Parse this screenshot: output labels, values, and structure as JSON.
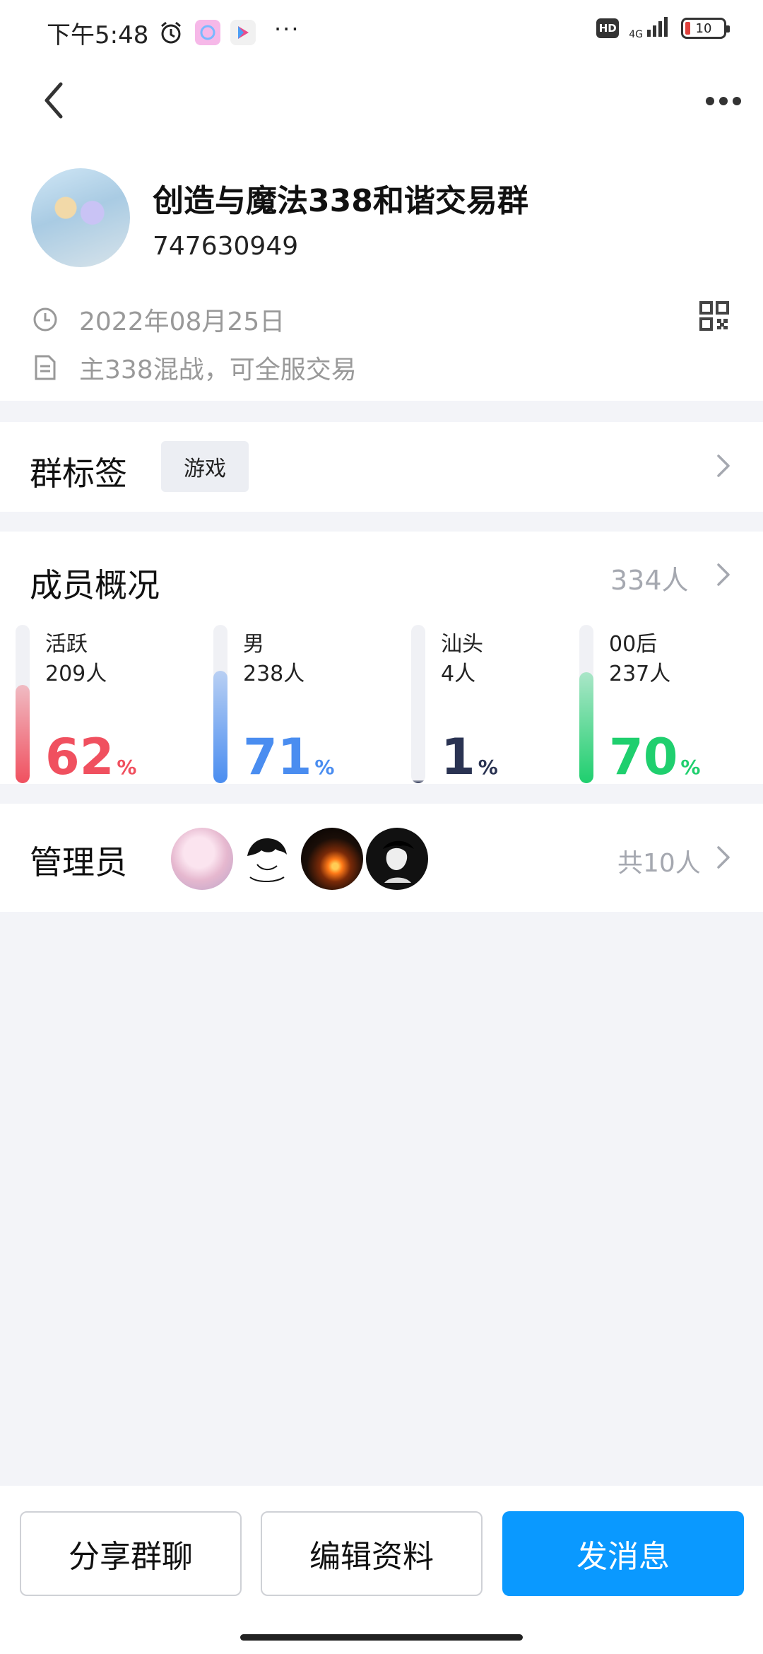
{
  "status_bar": {
    "time": "下午5:48",
    "hd_label": "HD",
    "network_label": "4G",
    "battery_level": "10",
    "more_label": "···"
  },
  "nav": {
    "back_icon": "chevron-left-icon",
    "more_icon": "more-horizontal-icon"
  },
  "group": {
    "name": "创造与魔法338和谐交易群",
    "id": "747630949",
    "created_date": "2022年08月25日",
    "description": "主338混战，可全服交易"
  },
  "tags": {
    "title": "群标签",
    "items": [
      "游戏"
    ]
  },
  "members": {
    "title": "成员概况",
    "total": "334人",
    "stats": [
      {
        "label": "活跃",
        "count": "209人",
        "percent": "62",
        "fraction": 0.62,
        "color": "#f0505f"
      },
      {
        "label": "男",
        "count": "238人",
        "percent": "71",
        "fraction": 0.71,
        "color": "#4a8df0"
      },
      {
        "label": "汕头",
        "count": "4人",
        "percent": "1",
        "fraction": 0.01,
        "color": "#2a3352"
      },
      {
        "label": "00后",
        "count": "237人",
        "percent": "70",
        "fraction": 0.7,
        "color": "#1fcf6e"
      }
    ],
    "percent_sign": "%"
  },
  "admins": {
    "title": "管理员",
    "total": "共10人"
  },
  "actions": {
    "share": "分享群聊",
    "edit": "编辑资料",
    "send": "发消息"
  },
  "colors": {
    "accent": "#0a99ff",
    "background": "#f3f4f8"
  }
}
